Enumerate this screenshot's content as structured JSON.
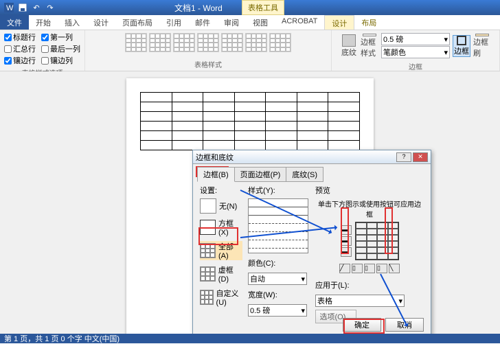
{
  "titlebar": {
    "doc": "文档1 - Word",
    "contextual": "表格工具"
  },
  "tabs": {
    "file": "文件",
    "home": "开始",
    "insert": "插入",
    "design": "设计",
    "layout": "页面布局",
    "ref": "引用",
    "mail": "邮件",
    "review": "审阅",
    "view": "视图",
    "acrobat": "ACROBAT",
    "tbl_design": "设计",
    "tbl_layout": "布局"
  },
  "ribbon": {
    "opts": {
      "header_row": "标题行",
      "first_col": "第一列",
      "total_row": "汇总行",
      "last_col": "最后一列",
      "banded_row": "镶边行",
      "banded_col": "镶边列",
      "group": "表格样式选项"
    },
    "styles_group": "表格样式",
    "borders": {
      "shading": "底纹",
      "style": "边框样式",
      "weight": "0.5 磅",
      "pen": "笔颜色",
      "border_btn": "边框",
      "painter": "边框刷",
      "group": "边框"
    }
  },
  "dialog": {
    "title": "边框和底纹",
    "tabs": {
      "border": "边框(B)",
      "page": "页面边框(P)",
      "shading": "底纹(S)"
    },
    "settings_label": "设置:",
    "settings": {
      "none": "无(N)",
      "box": "方框(X)",
      "all": "全部(A)",
      "grid": "虚框(D)",
      "custom": "自定义(U)"
    },
    "style_label": "样式(Y):",
    "color_label": "颜色(C):",
    "color_val": "自动",
    "width_label": "宽度(W):",
    "width_val": "0.5 磅",
    "preview_label": "预览",
    "preview_hint": "单击下方图示或使用按钮可应用边框",
    "apply_label": "应用于(L):",
    "apply_val": "表格",
    "options": "选项(O)...",
    "ok": "确定",
    "cancel": "取消"
  },
  "status": "第 1 页，共 1 页   0 个字    中文(中国)"
}
